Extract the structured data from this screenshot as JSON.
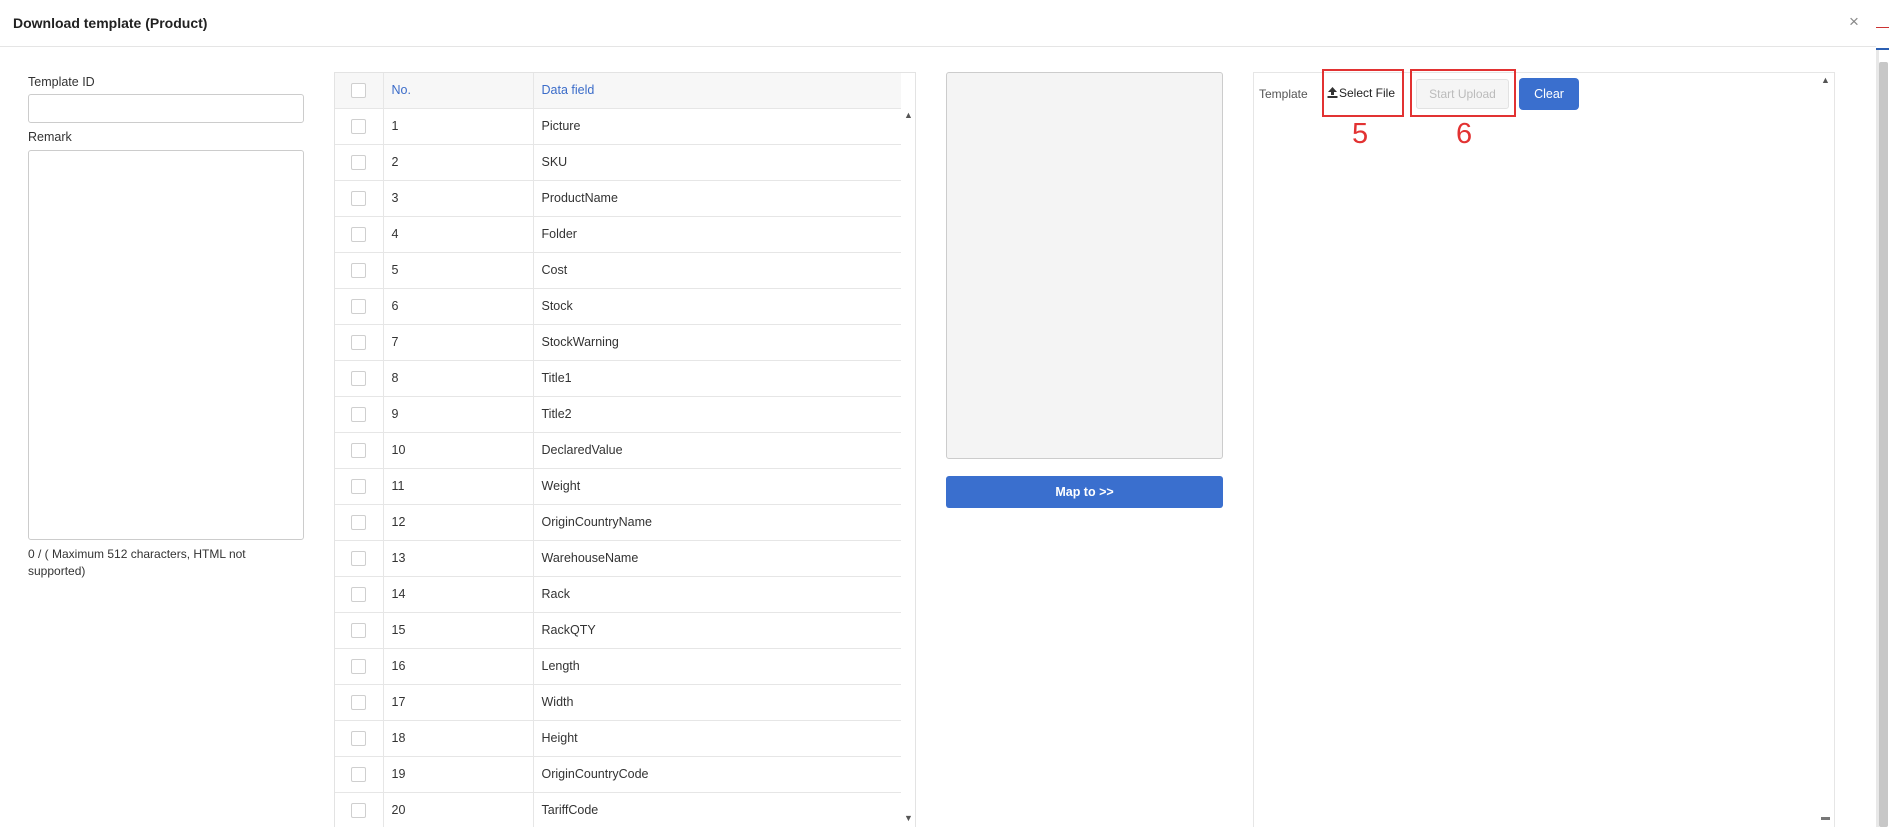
{
  "dialog": {
    "title": "Download template (Product)",
    "close_glyph": "×"
  },
  "form": {
    "template_id_label": "Template ID",
    "template_id_value": "",
    "remark_label": "Remark",
    "remark_value": "",
    "char_count": "0 / ( Maximum 512 characters, HTML not supported)"
  },
  "fields_table": {
    "headers": {
      "no": "No.",
      "field": "Data field"
    },
    "rows": [
      {
        "no": "1",
        "field": "Picture"
      },
      {
        "no": "2",
        "field": "SKU"
      },
      {
        "no": "3",
        "field": "ProductName"
      },
      {
        "no": "4",
        "field": "Folder"
      },
      {
        "no": "5",
        "field": "Cost"
      },
      {
        "no": "6",
        "field": "Stock"
      },
      {
        "no": "7",
        "field": "StockWarning"
      },
      {
        "no": "8",
        "field": "Title1"
      },
      {
        "no": "9",
        "field": "Title2"
      },
      {
        "no": "10",
        "field": "DeclaredValue"
      },
      {
        "no": "11",
        "field": "Weight"
      },
      {
        "no": "12",
        "field": "OriginCountryName"
      },
      {
        "no": "13",
        "field": "WarehouseName"
      },
      {
        "no": "14",
        "field": "Rack"
      },
      {
        "no": "15",
        "field": "RackQTY"
      },
      {
        "no": "16",
        "field": "Length"
      },
      {
        "no": "17",
        "field": "Width"
      },
      {
        "no": "18",
        "field": "Height"
      },
      {
        "no": "19",
        "field": "OriginCountryCode"
      },
      {
        "no": "20",
        "field": "TariffCode"
      }
    ]
  },
  "mapping": {
    "map_button": "Map to >>"
  },
  "upload": {
    "template_label": "Template",
    "select_file": "Select File",
    "start_upload": "Start Upload",
    "clear": "Clear"
  },
  "annotations": {
    "marker_5": "5",
    "marker_6": "6"
  },
  "colors": {
    "primary": "#3a6fce",
    "annotation": "#e23232",
    "header_text": "#3b6cc9"
  }
}
